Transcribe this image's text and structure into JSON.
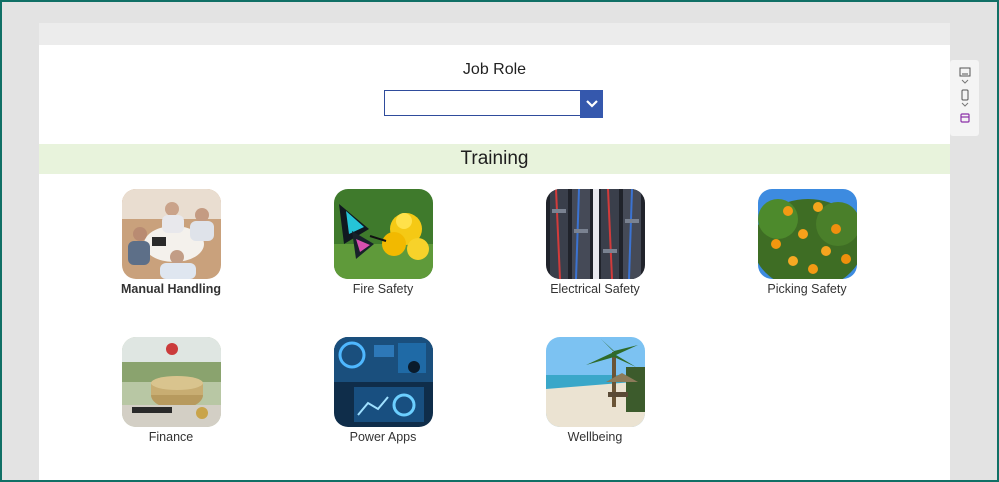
{
  "header": {
    "job_role_label": "Job Role"
  },
  "dropdown": {
    "selected_value": ""
  },
  "section": {
    "title": "Training"
  },
  "tiles": [
    {
      "label": "Manual Handling",
      "image": "office-meeting-photo",
      "bold": true
    },
    {
      "label": "Fire Safety",
      "image": "butterfly-flower-photo"
    },
    {
      "label": "Electrical Safety",
      "image": "server-cables-photo"
    },
    {
      "label": "Picking Safety",
      "image": "orange-tree-photo"
    },
    {
      "label": "Finance",
      "image": "coins-money-photo"
    },
    {
      "label": "Power Apps",
      "image": "digital-dashboard-photo"
    },
    {
      "label": "Wellbeing",
      "image": "beach-palm-photo"
    }
  ],
  "colors": {
    "accent": "#3558ad",
    "band": "#e8f3dc",
    "frame": "#107066",
    "side_icon_active": "#8b2fa8"
  },
  "side_panel": {
    "icons": [
      "screen-layout-icon",
      "phone-layout-icon",
      "app-layout-icon"
    ]
  }
}
